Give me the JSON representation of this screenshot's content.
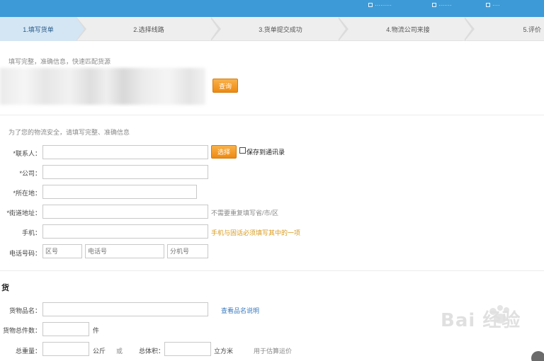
{
  "topbar": {
    "items": [
      {
        "icon": "user-icon",
        "label": "·········"
      },
      {
        "icon": "cart-icon",
        "label": "·······"
      },
      {
        "icon": "help-icon",
        "label": "····"
      }
    ]
  },
  "steps": [
    {
      "label": "1.填写货单",
      "active": true
    },
    {
      "label": "2.选择线路",
      "active": false
    },
    {
      "label": "3.货单提交成功",
      "active": false
    },
    {
      "label": "4.物流公司来接",
      "active": false
    },
    {
      "label": "5.评价",
      "active": false
    }
  ],
  "quick": {
    "hint": "填写完整，准确信息，快速匹配货源",
    "button_label": "查询"
  },
  "contact": {
    "hint": "为了您的物流安全，请填写完整、准确信息",
    "fields": {
      "contact_label": "*联系人：",
      "company_label": "*公司：",
      "location_label": "*所在地：",
      "address_label": "*街道地址：",
      "mobile_label": "手机：",
      "phone_label": "电话号码："
    },
    "select_button": "选择",
    "save_checkbox_label": "保存到通讯录",
    "address_note": "不需要重复填写省/市/区",
    "mobile_note": "手机与固话必须填写其中的一项",
    "phone_placeholders": {
      "area": "区号",
      "number": "电话号",
      "ext": "分机号"
    }
  },
  "cargo": {
    "section_title": "货",
    "name_label": "货物品名：",
    "name_link": "查看品名说明",
    "count_label": "货物总件数：",
    "count_unit": "件",
    "weight_label": "总重量：",
    "weight_unit": "公斤",
    "or_text": "或",
    "volume_label": "总体积：",
    "volume_unit": "立方米",
    "volume_note": "用于估算运价"
  },
  "watermark": {
    "text": "Bai 经验"
  }
}
